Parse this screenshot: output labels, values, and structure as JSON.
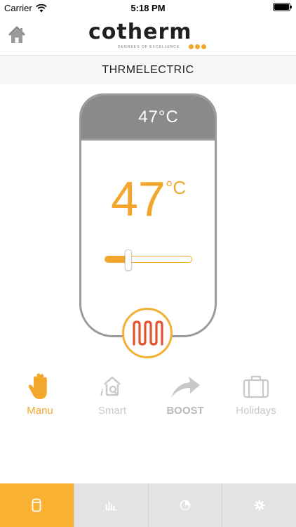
{
  "status": {
    "carrier": "Carrier",
    "time": "5:18 PM"
  },
  "header": {
    "logo_text": "cotherm",
    "logo_tagline": "DEGREES OF EXCELLENCE"
  },
  "device": {
    "name": "THRMELECTRIC"
  },
  "tank": {
    "top_temp": "47°C",
    "temp_value": "47",
    "temp_unit": "°C",
    "slider_level": 0.27
  },
  "modes": [
    {
      "label": "Manu",
      "icon": "hand-icon",
      "active": true
    },
    {
      "label": "Smart",
      "icon": "smart-house-icon",
      "active": false
    },
    {
      "label": "BOOST",
      "icon": "boost-arrow-icon",
      "active": false
    },
    {
      "label": "Holidays",
      "icon": "suitcase-icon",
      "active": false
    }
  ],
  "tabs": [
    {
      "icon": "water-heater-icon",
      "active": true
    },
    {
      "icon": "bar-chart-icon",
      "active": false
    },
    {
      "icon": "pie-chart-icon",
      "active": false
    },
    {
      "icon": "gear-icon",
      "active": false
    }
  ],
  "colors": {
    "accent": "#f2a72c",
    "heater": "#e5532c",
    "grey": "#8a8a8a"
  }
}
